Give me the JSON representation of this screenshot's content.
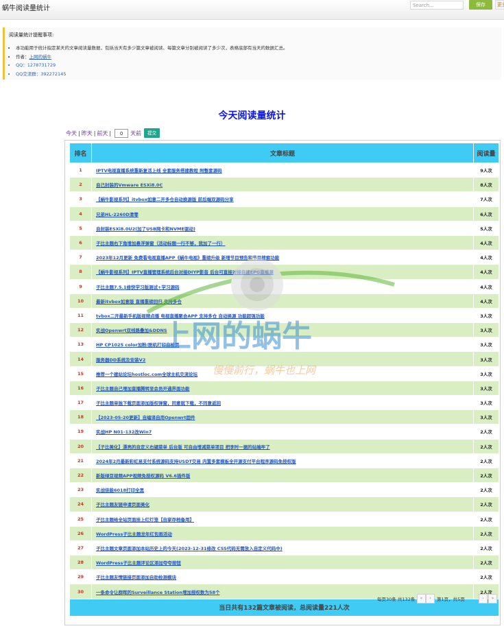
{
  "app": {
    "title": "蜗牛阅读量统计"
  },
  "toolbar": {
    "search_placeholder": "Search...",
    "save_label": "保存",
    "extra_label": "更多"
  },
  "notice": {
    "title": "阅读量统计提醒事项:",
    "items": [
      "本功能用于统计指定某天的文章阅读量数据，包括当天有多少篇文章被阅读、每篇文章分别被阅读了多少次，表格底部有当天的数据汇总。"
    ],
    "author_label": "作者：",
    "author_value": "上网的蜗牛",
    "qq_label": "QQ：",
    "qq_value": "1278731729",
    "group_label": "QQ交流群：",
    "group_value": "392272145"
  },
  "page_title": "今天阅读量统计",
  "filter": {
    "today": "今天",
    "yesterday": "昨天",
    "day_before": "前天",
    "days_value": "0",
    "days_suffix": "天前",
    "submit_label": "提交"
  },
  "table": {
    "headers": {
      "rank": "排名",
      "title": "文章标题",
      "count": "阅读量"
    },
    "rows": [
      {
        "rank": "1",
        "title": "IPTV电视直播系统重新复活上线 全套服务搭建教程 附整套源码",
        "count": "9人次"
      },
      {
        "rank": "2",
        "title": "自己封装的Vmware ESXi8.0C",
        "count": "8人次"
      },
      {
        "rank": "3",
        "title": "【蜗牛影视系列】itvbox如意二开多仓自动换源版 前后端双源码分享",
        "count": "7人次"
      },
      {
        "rank": "4",
        "title": "兄弟HL-2260D清零",
        "count": "6人次"
      },
      {
        "rank": "5",
        "title": "自封装ESXi8.0U2(加了USB网卡和NVME驱动)",
        "count": "5人次"
      },
      {
        "rank": "6",
        "title": "子比主题右下角增加悬浮弹窗（活动标题一行不够，我加了一行）",
        "count": "4人次"
      },
      {
        "rank": "7",
        "title": "2023年12月更新 免费看电视直播APP《蜗牛电视》重磅升级 新增节目预告和节目搜索功能",
        "count": "4人次"
      },
      {
        "rank": "8",
        "title": "【蜗牛影视系列】IPTV直播管理系统后台对接DIYP影音 后台可直接对接自建EPG直播源",
        "count": "4人次"
      },
      {
        "rank": "9",
        "title": "子比主题7.5.1修快学习版测试+学习源码",
        "count": "4人次"
      },
      {
        "rank": "10",
        "title": "最新itvbox如意版 直播重磅回归 支持多仓",
        "count": "4人次"
      },
      {
        "rank": "11",
        "title": "tvbox二开最新手机版视频点播 电视直播聚合APP 支持多仓 自动换源 功能超强功能",
        "count": "3人次"
      },
      {
        "rank": "12",
        "title": "实战Openwrt双线路叠加&DDNS",
        "count": "3人次"
      },
      {
        "rank": "13",
        "title": "HP CP1025 color加粉/脱机打印自检页",
        "count": "3人次"
      },
      {
        "rank": "14",
        "title": "服务器DD系统及安装V2",
        "count": "3人次"
      },
      {
        "rank": "15",
        "title": "推荐一个建站论坛hostloc.com全球主机交流论坛",
        "count": "3人次"
      },
      {
        "rank": "16",
        "title": "子比主题自己增加直播腾转至会员开通界面功能",
        "count": "3人次"
      },
      {
        "rank": "17",
        "title": "子比主题单独下载页面添加版权弹窗，同意就下载，不同意返回",
        "count": "3人次"
      },
      {
        "rank": "18",
        "title": "【2023-05-20更新】自编译自用Openwrt固件",
        "count": "3人次"
      },
      {
        "rank": "19",
        "title": "实战HP N01-132改Win7",
        "count": "2人次"
      },
      {
        "rank": "20",
        "title": "【子比美化】漂亮的自定义右键菜单 后台版 可自由增减菜单项目 把李时一据的站端牢了",
        "count": "2人次"
      },
      {
        "rank": "21",
        "title": "2024年2月最新彩虹易支付系统源码支持USDT交易 内置多套模板全开源支付平台程序源码免授权版",
        "count": "2人次"
      },
      {
        "rank": "22",
        "title": "新版绿豆视频APP视频免授权源码 V6.6插件版",
        "count": "2人次"
      },
      {
        "rank": "23",
        "title": "实战佳能6018打印全黑",
        "count": "2人次"
      },
      {
        "rank": "24",
        "title": "子比主题友链申请页面美化",
        "count": "2人次"
      },
      {
        "rank": "25",
        "title": "子比主题给全站页面挂上红灯笼【自家存档备用】",
        "count": "2人次"
      },
      {
        "rank": "26",
        "title": "WordPress子比主题龙年红包雨活动",
        "count": "2人次"
      },
      {
        "rank": "27",
        "title": "子比主题文章页面添加本站历史上的今天(2023-12-31修改 CSS代码无需放入自定义代码中)",
        "count": "2人次"
      },
      {
        "rank": "28",
        "title": "WordPress子比主题评论区添加夸夸按钮",
        "count": "2人次"
      },
      {
        "rank": "29",
        "title": "子比主题友情链接页面添加自助检测模块",
        "count": "2人次"
      },
      {
        "rank": "30",
        "title": "一条命令让群晖的Surveillance Station增加授权数为58个",
        "count": "2人次"
      }
    ],
    "summary": "当日共有132篇文章被阅读，总阅读量221人次"
  },
  "pager": {
    "info": "每页30条 共132条",
    "first": "«",
    "prev": "‹",
    "status": "第1页，共5页",
    "next": "›",
    "last": "»"
  },
  "watermark": {
    "brand": "上网的蜗牛",
    "slogan": "慢慢前行，蜗牛也上网"
  },
  "colors": {
    "header_cyan": "#40cbf5",
    "row_green": "#d9efc3",
    "title_blue": "#0c17e6",
    "submit_teal": "#21a58e",
    "save_green": "#8cba3c",
    "rank_red": "#c0392b"
  }
}
